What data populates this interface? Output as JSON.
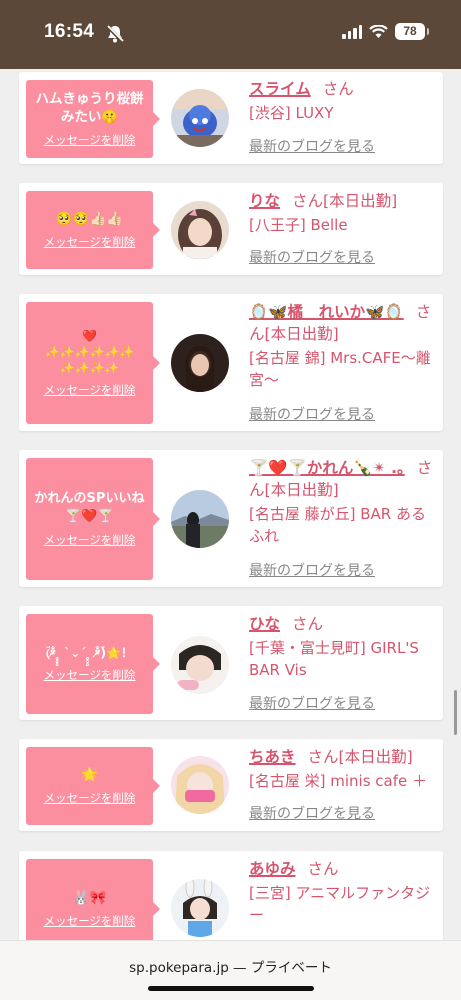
{
  "status": {
    "time": "16:54",
    "battery": "78"
  },
  "delete_label": "メッセージを削除",
  "blog_label": "最新のブログを見る",
  "san_label": "さん",
  "cards": [
    {
      "message": "ハムきゅうり桜餅\nみたい🤫",
      "name": "スライム",
      "name_suffix": "",
      "place": "[渋谷] LUXY"
    },
    {
      "message": "🥺🥺👍🏻👍🏻",
      "name": "りな",
      "name_suffix": "[本日出勤]",
      "place": "[八王子] Belle"
    },
    {
      "message": "❤️\n✨✨✨✨✨✨\n✨✨✨✨",
      "name": "🪞🦋橘　れいか🦋🪞",
      "name_suffix": "[本日出勤]",
      "place": "[名古屋 錦] Mrs.CAFE〜離宮〜"
    },
    {
      "message": "かれんのSPいいね\n🍸❤️🍸",
      "name": "🍸❤️🍸かれん🍾✴︎ .｡",
      "name_suffix": "[本日出勤]",
      "place": "[名古屋 藤が丘] BAR あるふれ"
    },
    {
      "message": "(ؔᵒ̷̵̐ ̥̥̥ ˋ⌄ˊ ̥̥̥ ᵒ̷̵̐ؔ)🌟！",
      "name": "ひな",
      "name_suffix": "",
      "place": "[千葉・富士見町] GIRL'S BAR Vis"
    },
    {
      "message": "🌟",
      "name": "ちあき",
      "name_suffix": "[本日出勤]",
      "place": "[名古屋 栄] minis cafe ＋"
    },
    {
      "message": "🐰🎀",
      "name": "あゆみ",
      "name_suffix": "",
      "place": "[三宮] アニマルファンタジー"
    }
  ],
  "bottom": {
    "url": "sp.pokepara.jp — プライベート"
  },
  "colors": {
    "header": "#5b4839",
    "bubble": "#fb8fa0",
    "name": "#d6556c",
    "link": "#888888"
  }
}
